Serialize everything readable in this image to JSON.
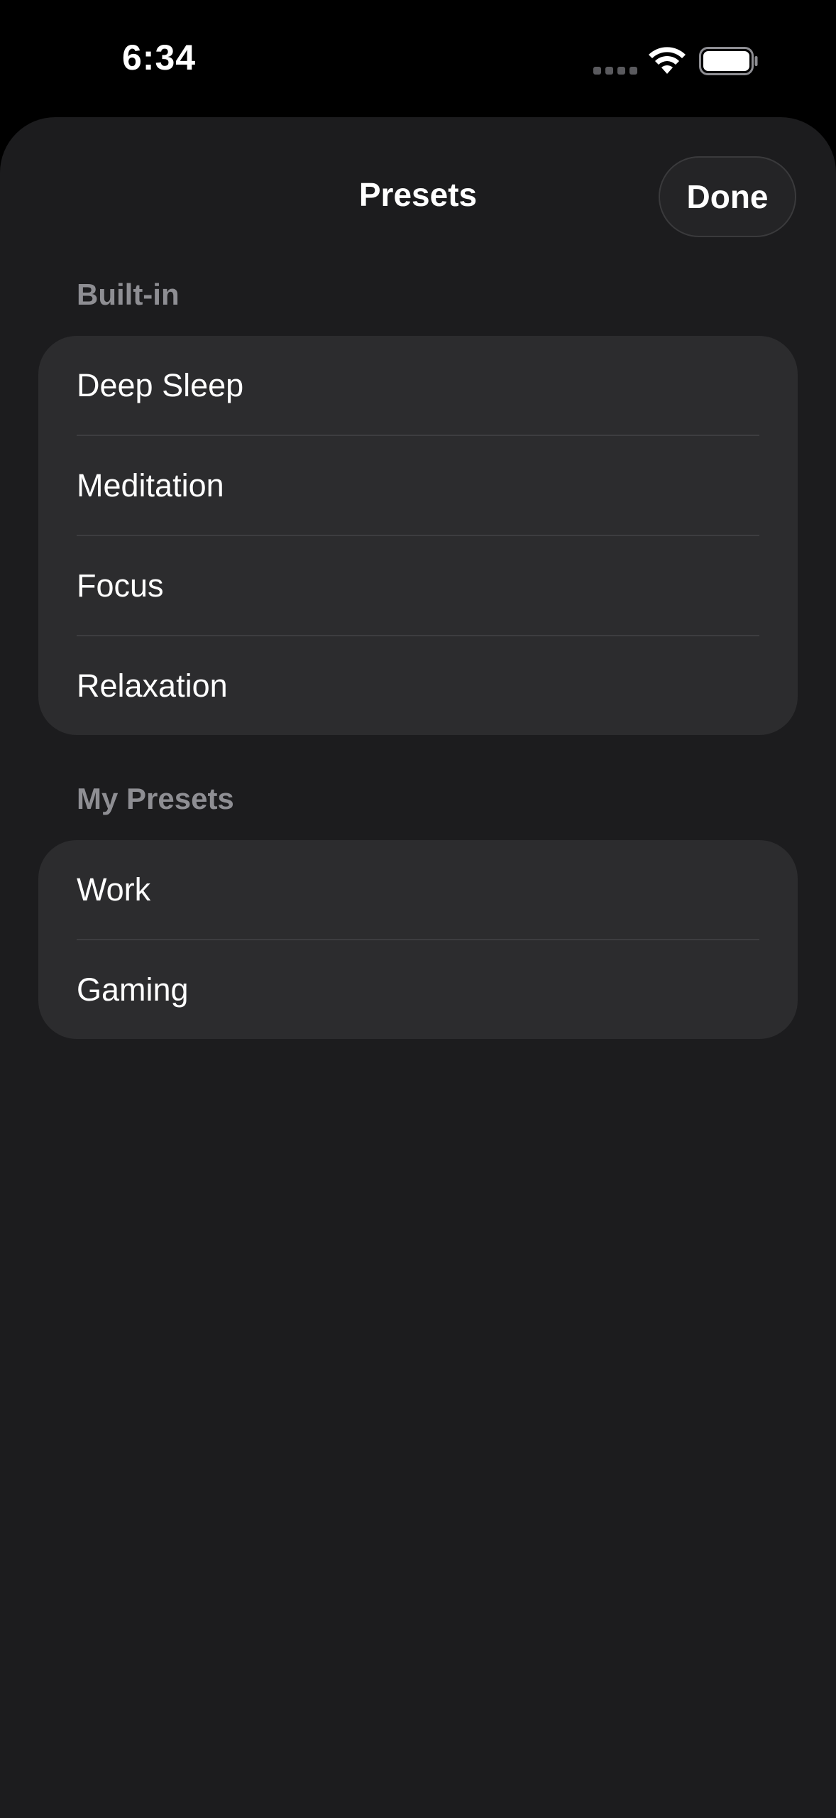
{
  "status_bar": {
    "time": "6:34"
  },
  "sheet": {
    "title": "Presets",
    "done_label": "Done"
  },
  "sections": {
    "builtin": {
      "header": "Built-in",
      "items": [
        "Deep Sleep",
        "Meditation",
        "Focus",
        "Relaxation"
      ]
    },
    "my_presets": {
      "header": "My Presets",
      "items": [
        "Work",
        "Gaming"
      ]
    }
  },
  "colors": {
    "background": "#000000",
    "sheet": "#1c1c1e",
    "group": "#2c2c2e",
    "secondary_text": "#8e8e93",
    "primary_text": "#ffffff"
  },
  "icons": [
    "wifi-icon",
    "battery-icon",
    "cellular-signal-icon"
  ]
}
